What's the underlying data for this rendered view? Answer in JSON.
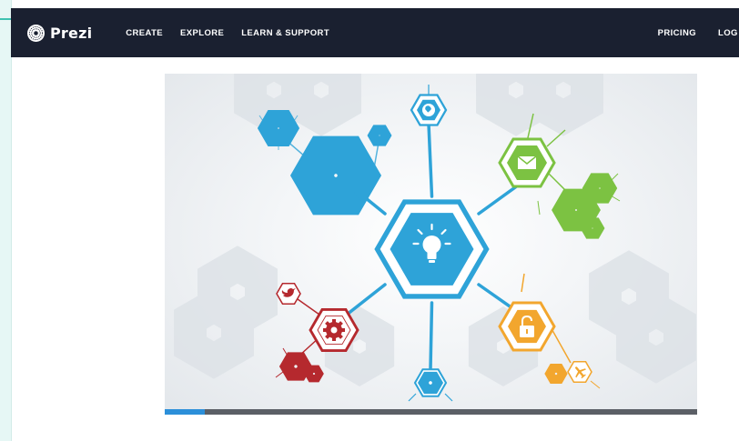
{
  "navbar": {
    "brand": "Prezi",
    "links": [
      "CREATE",
      "EXPLORE",
      "LEARN & SUPPORT"
    ],
    "pricing": "PRICING",
    "login": "LOG IN"
  },
  "video": {
    "progress": 0.075,
    "icons": [
      "lightbulb-icon",
      "globe-icon",
      "mail-icon",
      "gear-icon",
      "padlock-icon",
      "twitter-icon",
      "airplane-icon"
    ],
    "colors": {
      "blue": "#2ea3d8",
      "green": "#7cc242",
      "red": "#b5292e",
      "orange": "#f2a62e",
      "navbar": "#1a2030"
    }
  }
}
